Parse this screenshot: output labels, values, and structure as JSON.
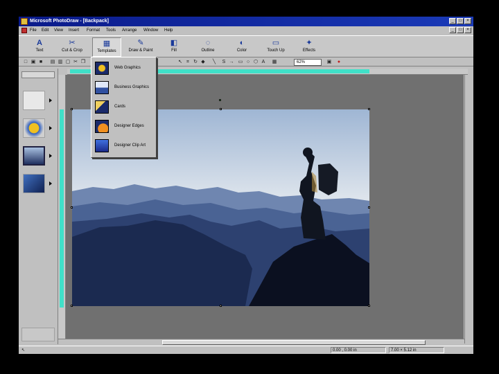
{
  "window": {
    "title": "Microsoft PhotoDraw - [Backpack]",
    "controls": [
      "_",
      "□",
      "×"
    ]
  },
  "menu": {
    "items": [
      "File",
      "Edit",
      "View",
      "Insert",
      "Format",
      "Tools",
      "Arrange",
      "Window",
      "Help"
    ]
  },
  "toolbar": {
    "buttons": [
      {
        "label": "Text",
        "icon": "text-a-icon"
      },
      {
        "label": "Cut & Crop",
        "icon": "scissors-icon"
      },
      {
        "label": "Templates",
        "icon": "templates-icon"
      },
      {
        "label": "Draw & Paint",
        "icon": "paint-brush-icon"
      },
      {
        "label": "Fill",
        "icon": "paint-bucket-icon"
      },
      {
        "label": "Outline",
        "icon": "outline-icon"
      },
      {
        "label": "Color",
        "icon": "color-icon"
      },
      {
        "label": "Touch Up",
        "icon": "touch-up-icon"
      },
      {
        "label": "Effects",
        "icon": "wand-icon"
      }
    ]
  },
  "standard_toolbar": {
    "zoom": "62%"
  },
  "templates_menu": {
    "items": [
      {
        "label": "Web Graphics",
        "icon": "web-graphics-icon"
      },
      {
        "label": "Business Graphics",
        "icon": "business-graphics-icon"
      },
      {
        "label": "Cards",
        "icon": "cards-icon"
      },
      {
        "label": "Designer Edges",
        "icon": "designer-edges-icon"
      },
      {
        "label": "Designer Clip Art",
        "icon": "designer-clip-art-icon"
      }
    ]
  },
  "status": {
    "position": "0.00 , 0.00 in",
    "size": "7.00 × 5.12 in"
  },
  "colors": {
    "titlebar": "#0a1a8a",
    "ruler_selection": "#40e0c8",
    "workspace": "#707070"
  }
}
